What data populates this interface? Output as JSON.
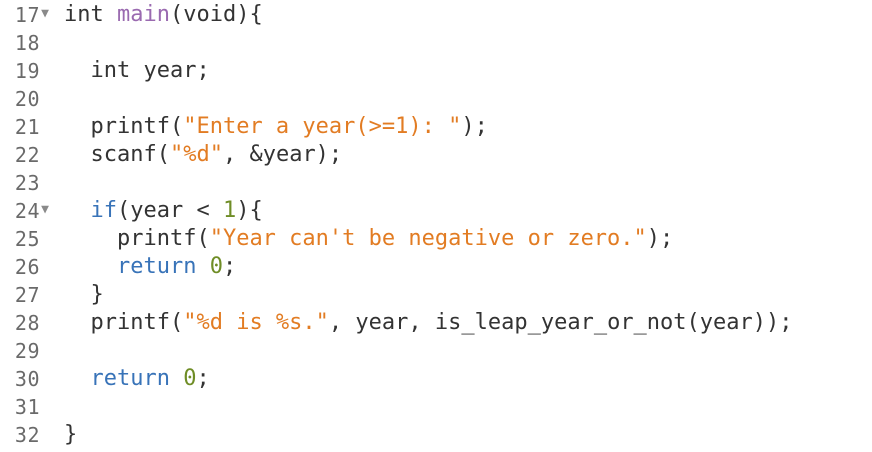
{
  "colors": {
    "background": "#ffffff",
    "line_number": "#6a6a6a",
    "plain": "#333333",
    "keyword": "#3873b8",
    "string": "#e27c23",
    "number": "#6f8d26",
    "function_name": "#9a6ab0"
  },
  "editor": {
    "fold_marker": "▼",
    "lines": [
      {
        "number": "17",
        "fold": true,
        "indent": "",
        "tokens": [
          {
            "t": "int",
            "k": "plain"
          },
          {
            "t": " ",
            "k": "plain"
          },
          {
            "t": "main",
            "k": "fn"
          },
          {
            "t": "(void){",
            "k": "plain"
          }
        ]
      },
      {
        "number": "18",
        "fold": false,
        "indent": "",
        "tokens": []
      },
      {
        "number": "19",
        "fold": false,
        "indent": "  ",
        "tokens": [
          {
            "t": "int year;",
            "k": "plain"
          }
        ]
      },
      {
        "number": "20",
        "fold": false,
        "indent": "",
        "tokens": []
      },
      {
        "number": "21",
        "fold": false,
        "indent": "  ",
        "tokens": [
          {
            "t": "printf(",
            "k": "plain"
          },
          {
            "t": "\"Enter a year(>=1): \"",
            "k": "str"
          },
          {
            "t": ");",
            "k": "plain"
          }
        ]
      },
      {
        "number": "22",
        "fold": false,
        "indent": "  ",
        "tokens": [
          {
            "t": "scanf(",
            "k": "plain"
          },
          {
            "t": "\"%d\"",
            "k": "str"
          },
          {
            "t": ", &year);",
            "k": "plain"
          }
        ]
      },
      {
        "number": "23",
        "fold": false,
        "indent": "",
        "tokens": []
      },
      {
        "number": "24",
        "fold": true,
        "indent": "  ",
        "tokens": [
          {
            "t": "if",
            "k": "kw"
          },
          {
            "t": "(year < ",
            "k": "plain"
          },
          {
            "t": "1",
            "k": "num"
          },
          {
            "t": "){",
            "k": "plain"
          }
        ]
      },
      {
        "number": "25",
        "fold": false,
        "indent": "    ",
        "tokens": [
          {
            "t": "printf(",
            "k": "plain"
          },
          {
            "t": "\"Year can't be negative or zero.\"",
            "k": "str"
          },
          {
            "t": ");",
            "k": "plain"
          }
        ]
      },
      {
        "number": "26",
        "fold": false,
        "indent": "    ",
        "tokens": [
          {
            "t": "return",
            "k": "kw"
          },
          {
            "t": " ",
            "k": "plain"
          },
          {
            "t": "0",
            "k": "num"
          },
          {
            "t": ";",
            "k": "plain"
          }
        ]
      },
      {
        "number": "27",
        "fold": false,
        "indent": "  ",
        "tokens": [
          {
            "t": "}",
            "k": "plain"
          }
        ]
      },
      {
        "number": "28",
        "fold": false,
        "indent": "  ",
        "tokens": [
          {
            "t": "printf(",
            "k": "plain"
          },
          {
            "t": "\"%d is %s.\"",
            "k": "str"
          },
          {
            "t": ", year, is_leap_year_or_not(year));",
            "k": "plain"
          }
        ]
      },
      {
        "number": "29",
        "fold": false,
        "indent": "",
        "tokens": []
      },
      {
        "number": "30",
        "fold": false,
        "indent": "  ",
        "tokens": [
          {
            "t": "return",
            "k": "kw"
          },
          {
            "t": " ",
            "k": "plain"
          },
          {
            "t": "0",
            "k": "num"
          },
          {
            "t": ";",
            "k": "plain"
          }
        ]
      },
      {
        "number": "31",
        "fold": false,
        "indent": "",
        "tokens": []
      },
      {
        "number": "32",
        "fold": false,
        "indent": "",
        "tokens": [
          {
            "t": "}",
            "k": "plain"
          }
        ]
      }
    ]
  }
}
